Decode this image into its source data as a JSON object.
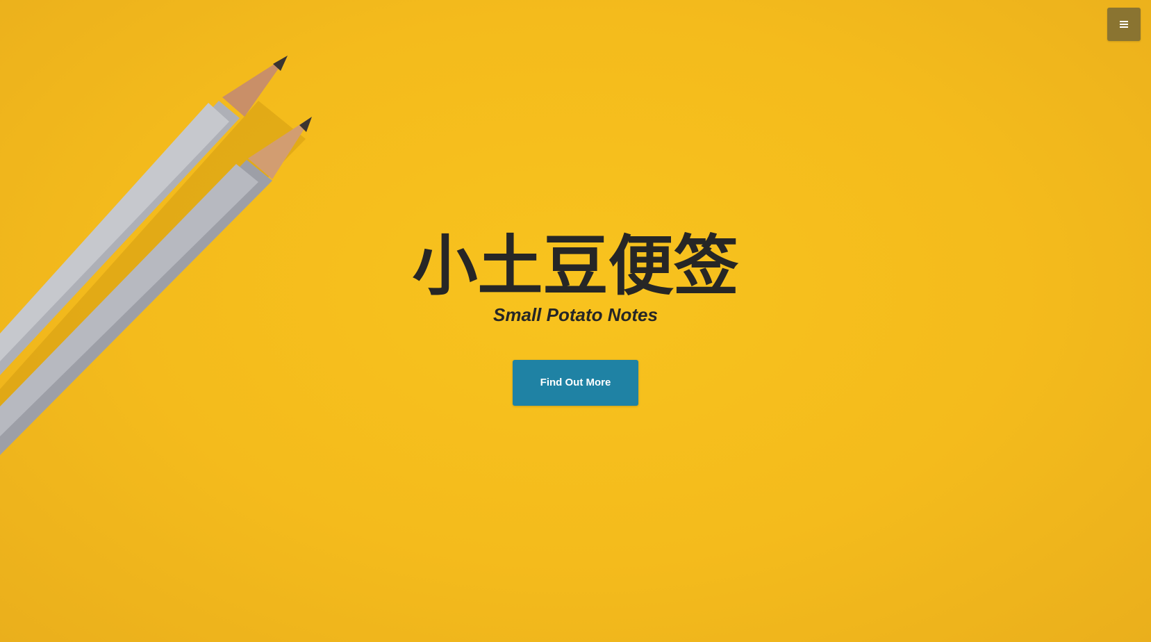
{
  "header": {
    "menu_icon": "hamburger-menu-icon"
  },
  "hero": {
    "title": "小土豆便签",
    "subtitle": "Small Potato Notes",
    "cta_label": "Find Out More",
    "background_image": "yellow-paper-with-two-pencils"
  },
  "colors": {
    "background": "#f5bd1b",
    "text": "#262626",
    "button": "#1f82a4",
    "menu_button": "#8a7431"
  }
}
